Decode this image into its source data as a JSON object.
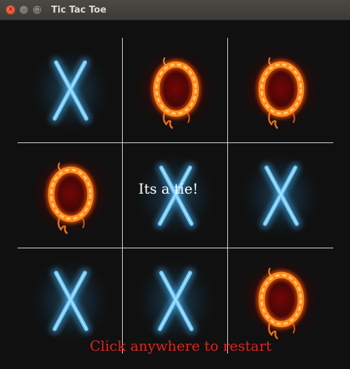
{
  "window": {
    "title": "Tic Tac Toe",
    "close_glyph": "✕",
    "minimize_glyph": "–",
    "maximize_glyph": "□"
  },
  "board": {
    "cells": [
      {
        "mark": "X"
      },
      {
        "mark": "O"
      },
      {
        "mark": "O"
      },
      {
        "mark": "O"
      },
      {
        "mark": "X"
      },
      {
        "mark": "X"
      },
      {
        "mark": "X"
      },
      {
        "mark": "X"
      },
      {
        "mark": "O"
      }
    ]
  },
  "status": {
    "result_text": "Its a tie!",
    "restart_text": "Click anywhere to restart"
  },
  "colors": {
    "x_glow": "#58b6e8",
    "o_fire": "#ff7a1a",
    "grid": "#d8d8d8",
    "restart": "#e0241f",
    "background": "#101010"
  }
}
